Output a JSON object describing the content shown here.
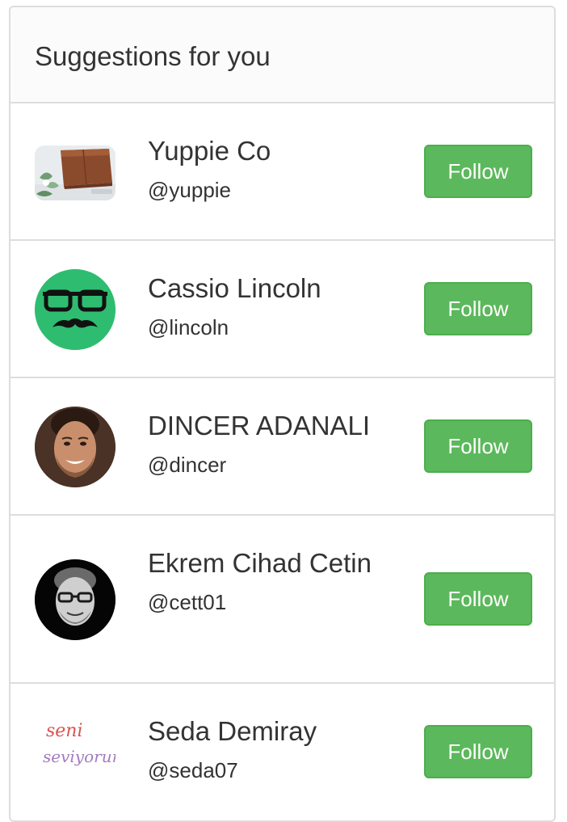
{
  "panel": {
    "title": "Suggestions for you"
  },
  "suggestions": [
    {
      "name": "Yuppie Co",
      "handle": "@yuppie",
      "button_label": "Follow"
    },
    {
      "name": "Cassio Lincoln",
      "handle": "@lincoln",
      "button_label": "Follow"
    },
    {
      "name": "DINCER ADANALI",
      "handle": "@dincer",
      "button_label": "Follow"
    },
    {
      "name": "Ekrem Cihad Cetin",
      "handle": "@cett01",
      "button_label": "Follow"
    },
    {
      "name": "Seda Demiray",
      "handle": "@seda07",
      "button_label": "Follow"
    }
  ],
  "avatar_text": {
    "seda_line1": "seni",
    "seda_line2": "seviyorum"
  },
  "colors": {
    "follow_button": "#5cb85c",
    "follow_border": "#4cae4c",
    "border": "#dddddd",
    "lincoln_avatar": "#2ebd70"
  }
}
